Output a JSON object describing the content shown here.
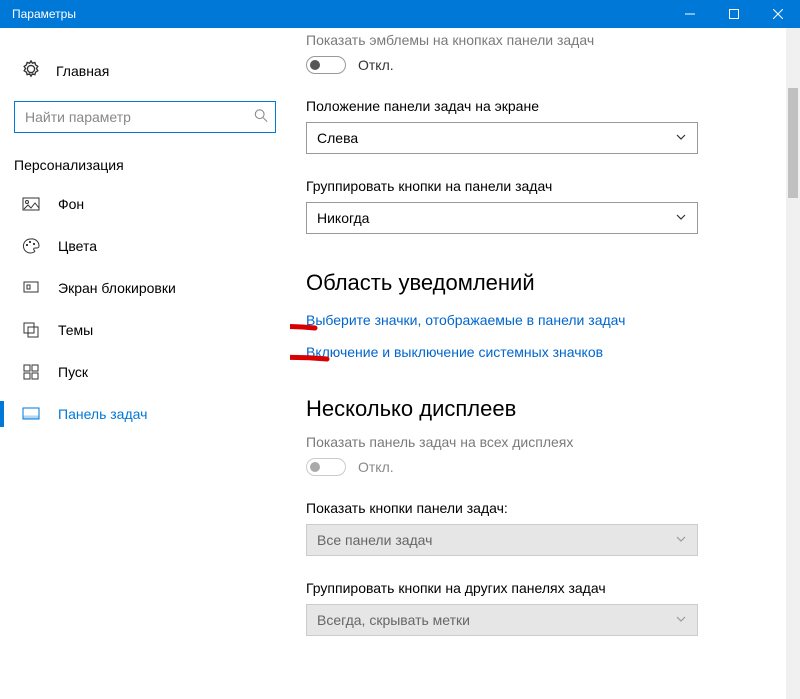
{
  "window": {
    "title": "Параметры"
  },
  "sidebar": {
    "home": "Главная",
    "search_placeholder": "Найти параметр",
    "category": "Персонализация",
    "items": [
      {
        "label": "Фон"
      },
      {
        "label": "Цвета"
      },
      {
        "label": "Экран блокировки"
      },
      {
        "label": "Темы"
      },
      {
        "label": "Пуск"
      },
      {
        "label": "Панель задач"
      }
    ]
  },
  "main": {
    "emblems_label": "Показать эмблемы на кнопках панели задач",
    "emblems_state": "Откл.",
    "position_label": "Положение панели задач на экране",
    "position_value": "Слева",
    "group_label": "Группировать кнопки на панели задач",
    "group_value": "Никогда",
    "section_notify": "Область уведомлений",
    "link_icons": "Выберите значки, отображаемые в панели задач",
    "link_toggle": "Включение и выключение системных значков",
    "section_displays": "Несколько дисплеев",
    "show_all_label": "Показать панель задач на всех дисплеях",
    "show_all_state": "Откл.",
    "buttons_label": "Показать кнопки панели задач:",
    "buttons_value": "Все панели задач",
    "group_other_label": "Группировать кнопки на других панелях задач",
    "group_other_value": "Всегда, скрывать метки"
  }
}
